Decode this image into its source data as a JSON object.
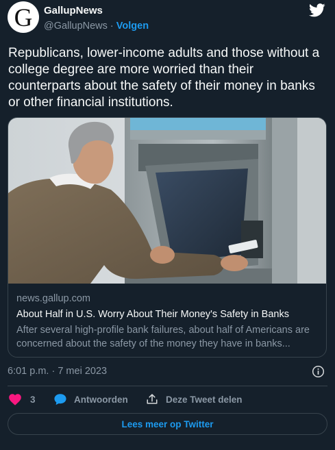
{
  "author": {
    "display_name": "GallupNews",
    "handle": "@GallupNews",
    "separator": "·",
    "follow_label": "Volgen",
    "avatar_letter": "G"
  },
  "tweet": {
    "text": "Republicans, lower-income adults and those without a college degree are more worried than their counterparts about the safety of their money in banks or other financial institutions.",
    "timestamp": "6:01 p.m. · 7 mei 2023"
  },
  "card": {
    "domain": "news.gallup.com",
    "title": "About Half in U.S. Worry About Their Money's Safety in Banks",
    "description": "After several high-profile bank failures, about half of Americans are concerned about the safety of the money they have in banks..."
  },
  "actions": {
    "like_count": "3",
    "reply_label": "Antwoorden",
    "share_label": "Deze Tweet delen"
  },
  "read_more_label": "Lees meer op Twitter",
  "colors": {
    "background": "#15202b",
    "accent": "#1d9bf0",
    "like": "#f91880",
    "border": "#38444d",
    "secondary_text": "#8b98a5"
  },
  "icons": [
    "twitter-logo-icon",
    "info-icon",
    "heart-icon",
    "reply-bubble-icon",
    "share-icon"
  ]
}
